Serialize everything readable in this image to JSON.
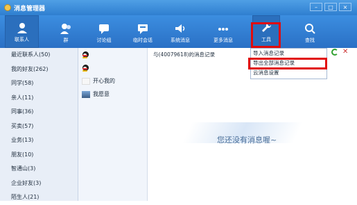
{
  "title_bar": {
    "title": "消息管理器"
  },
  "window_controls": {
    "minimize": "–",
    "maximize": "□",
    "close": "×"
  },
  "toolbar": {
    "contacts": "联系人",
    "group": "群",
    "discussion": "讨论组",
    "temp": "临时会话",
    "system": "系统消息",
    "more": "更多消息",
    "tools": "工具",
    "search": "查找"
  },
  "left_panel": {
    "items": [
      "最近联系人(50)",
      "我的好友(262)",
      "同学(58)",
      "亲人(11)",
      "同事(36)",
      "买卖(57)",
      "业务(13)",
      "朋友(10)",
      "智通山(3)",
      "企业好友(3)",
      "陌生人(21)"
    ]
  },
  "middle_panel": {
    "items": [
      "",
      "",
      "开心我的",
      "我愿意"
    ]
  },
  "content": {
    "header": "与(40079618)的消息记录",
    "empty": "您还没有消息喔~"
  },
  "dropdown": {
    "items": [
      "导入消息记录",
      "导出全部消息记录",
      "云消息设置"
    ]
  }
}
